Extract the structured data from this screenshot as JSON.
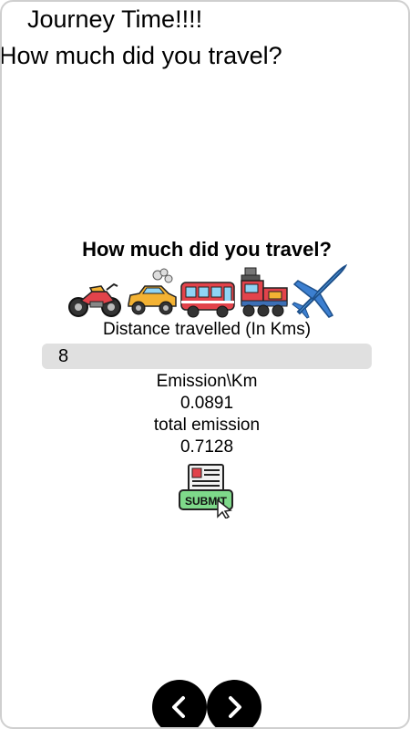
{
  "header": {
    "title": "Journey Time!!!!",
    "subtitle": "How much did you travel?"
  },
  "card": {
    "heading": "How much did you travel?",
    "vehicle_icons": [
      "motorcycle-icon",
      "car-icon",
      "bus-icon",
      "train-icon",
      "airplane-icon"
    ],
    "distance_label": "Distance travelled (In Kms)",
    "distance_value": "8",
    "emission_per_km_label": "Emission\\Km",
    "emission_per_km_value": "0.0891",
    "total_emission_label": "total emission",
    "total_emission_value": "0.7128",
    "submit_label": "SUBMIT"
  },
  "nav": {
    "back_icon": "chevron-left-icon",
    "forward_icon": "chevron-right-icon"
  }
}
